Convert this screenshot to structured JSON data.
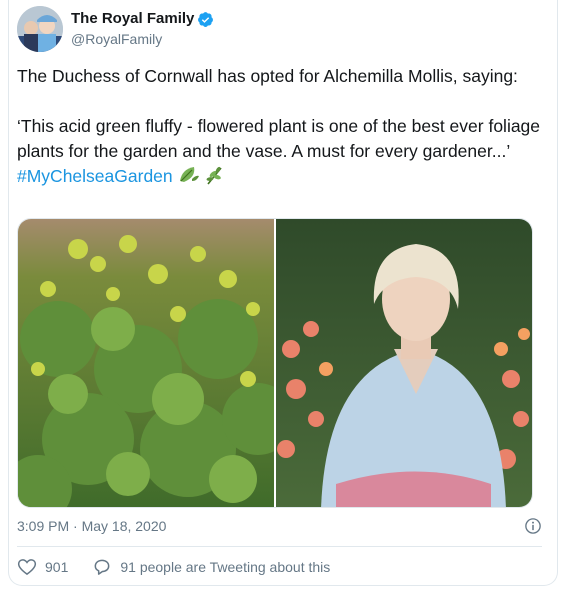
{
  "author": {
    "display_name": "The Royal Family",
    "handle": "@RoyalFamily",
    "avatar_icon": "profile-photo",
    "verified_icon": "verified-badge-icon"
  },
  "tweet": {
    "paragraph_1": "The Duchess of Cornwall has opted for Alchemilla Mollis, saying:",
    "paragraph_2_text": "‘This acid green fluffy - flowered plant is one of the best ever foliage plants for the garden and the vase. A must for every gardener...’ ",
    "hashtag": "#MyChelseaGarden",
    "emojis": [
      "leaf-fluttering-emoji",
      "herb-emoji"
    ]
  },
  "media": {
    "photos": [
      "alchemilla-mollis-plant-photo",
      "duchess-in-garden-photo"
    ]
  },
  "meta": {
    "timestamp": "3:09 PM · May 18, 2020"
  },
  "actions": {
    "like_count": "901",
    "conversation_label": "91 people are Tweeting about this"
  },
  "colors": {
    "link": "#1b95e0",
    "verified": "#1da1f2",
    "secondary_text": "#657786",
    "border": "#e1e8ed"
  }
}
